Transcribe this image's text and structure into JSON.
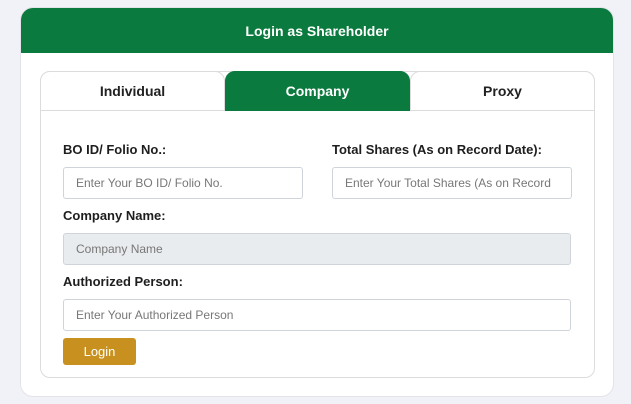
{
  "header": {
    "title": "Login as Shareholder"
  },
  "tabs": [
    {
      "label": "Individual",
      "active": false
    },
    {
      "label": "Company",
      "active": true
    },
    {
      "label": "Proxy",
      "active": false
    }
  ],
  "form": {
    "bo_id": {
      "label": "BO ID/ Folio No.:",
      "placeholder": "Enter Your BO ID/ Folio No.",
      "value": ""
    },
    "total_shares": {
      "label": "Total Shares (As on Record Date):",
      "placeholder": "Enter Your Total Shares (As on Record",
      "value": ""
    },
    "company_name": {
      "label": "Company Name:",
      "placeholder": "Company Name",
      "value": "",
      "disabled": true
    },
    "authorized_person": {
      "label": "Authorized Person:",
      "placeholder": "Enter Your Authorized Person",
      "value": ""
    },
    "submit_label": "Login"
  },
  "colors": {
    "brand_green": "#0b7a3e",
    "login_gold": "#c8901f",
    "background": "#f1f1f8"
  }
}
